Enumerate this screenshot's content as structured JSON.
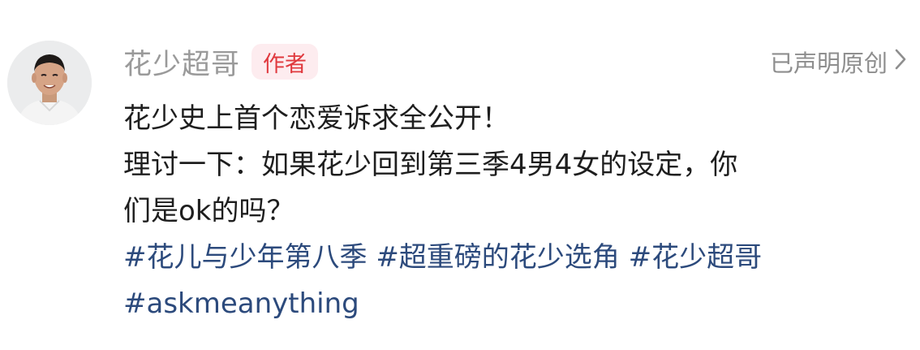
{
  "author": {
    "name": "花少超哥",
    "badge": "作者"
  },
  "original_statement": "已声明原创",
  "post": {
    "lines": [
      "花少史上首个恋爱诉求全公开！",
      "理讨一下：如果花少回到第三季4男4女的设定，你",
      "们是ok的吗？"
    ],
    "hashtags": [
      "#花儿与少年第八季",
      "#超重磅的花少选角",
      "#花少超哥",
      "#askmeanything"
    ]
  },
  "colors": {
    "name": "#9a9a9a",
    "badge_bg": "#fdecef",
    "badge_text": "#e0393e",
    "body_text": "#1e1e1e",
    "hashtag": "#2c4a7c"
  }
}
